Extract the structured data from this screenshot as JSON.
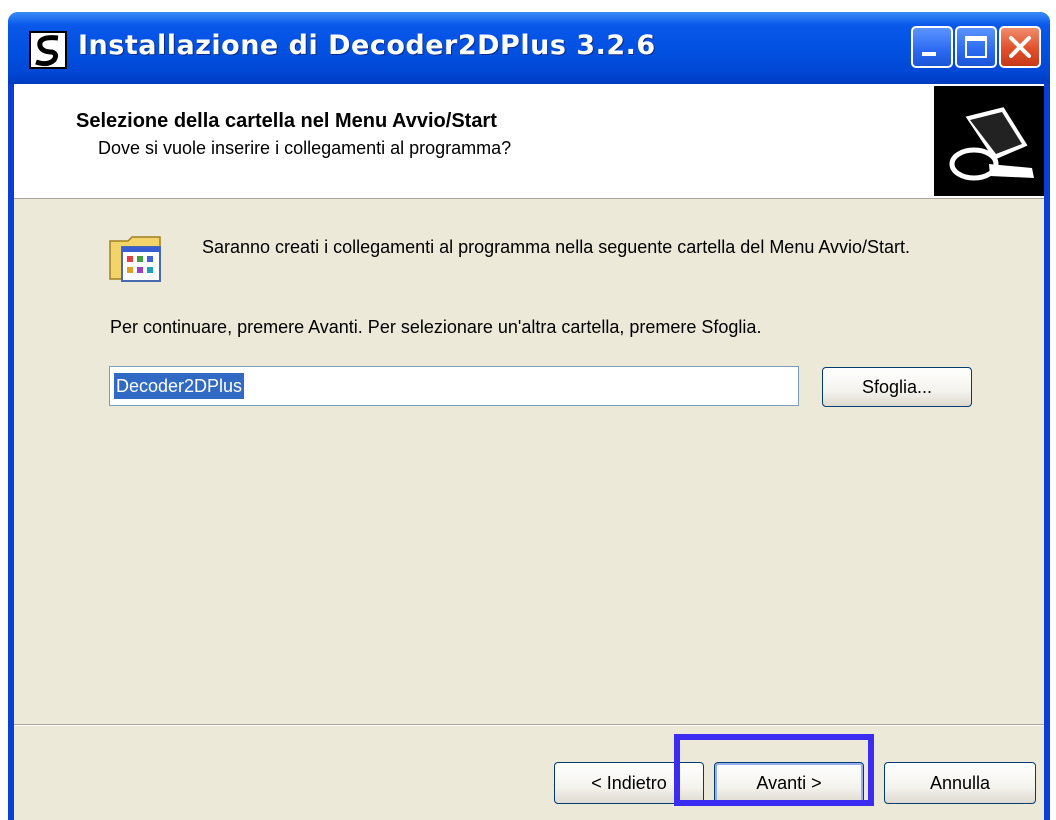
{
  "window": {
    "title": "Installazione di Decoder2DPlus 3.2.6",
    "icon": "setup-s-icon",
    "controls": [
      "minimize-icon",
      "maximize-icon",
      "close-icon"
    ]
  },
  "header": {
    "title": "Selezione della cartella nel Menu Avvio/Start",
    "subtitle": "Dove si vuole inserire i collegamenti al programma?",
    "image": "computer-disk-icon"
  },
  "content": {
    "info_icon": "start-menu-folder-icon",
    "info_text": "Saranno creati i collegamenti al programma nella seguente cartella del Menu Avvio/Start.",
    "instructions": "Per continuare, premere Avanti. Per selezionare un'altra cartella, premere Sfoglia.",
    "folder_value": "Decoder2DPlus",
    "browse_label": "Sfoglia..."
  },
  "footer": {
    "back_label": "< Indietro",
    "next_label": "Avanti >",
    "cancel_label": "Annulla"
  },
  "colors": {
    "titlebar": "#0250e0",
    "dialog_bg": "#ece9d8",
    "selection": "#316ac5",
    "highlight_box": "#3a2cf0"
  }
}
